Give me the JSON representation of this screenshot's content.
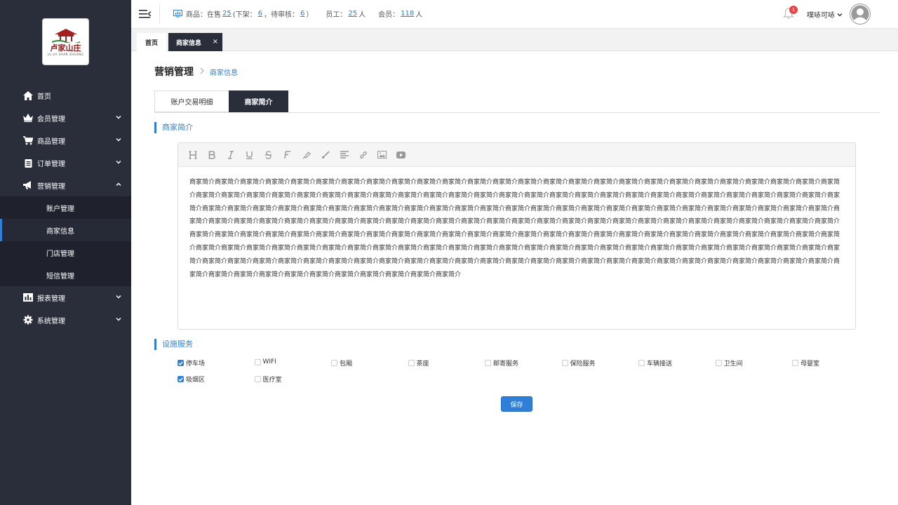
{
  "brand": {
    "logo_text": "卢家山庄",
    "logo_sub": "LU JIA SHAN ZHUANG"
  },
  "sidebar": {
    "items": [
      {
        "label": "首页",
        "icon": "home-icon"
      },
      {
        "label": "会员管理",
        "icon": "crown-icon"
      },
      {
        "label": "商品管理",
        "icon": "cart-icon"
      },
      {
        "label": "订单管理",
        "icon": "clipboard-icon"
      },
      {
        "label": "营销管理",
        "icon": "megaphone-icon"
      },
      {
        "label": "报表管理",
        "icon": "bar-chart-icon"
      },
      {
        "label": "系统管理",
        "icon": "gear-icon"
      }
    ],
    "submenu": [
      {
        "label": "账户管理"
      },
      {
        "label": "商家信息"
      },
      {
        "label": "门店管理"
      },
      {
        "label": "短信管理"
      }
    ]
  },
  "topbar": {
    "goods_label": "商品：在售",
    "on_sale": "25",
    "offshelf_label": "(下架：",
    "offshelf": "6",
    "pending_label": "，待审核：",
    "pending": "6",
    "close_paren": "）",
    "staff_label": "员工：",
    "staff": "25",
    "staff_unit": "人",
    "member_label": "会员：",
    "members": "118",
    "member_unit": "人",
    "notification_count": "1",
    "username": "噗哧可哧"
  },
  "page_tabs": {
    "home": "首页",
    "merchant": "商家信息",
    "close": "×"
  },
  "breadcrumb": {
    "title": "营销管理",
    "current": "商家信息"
  },
  "content_tabs": {
    "tab1": "账户交易明细",
    "tab2": "商家简介"
  },
  "intro": {
    "section_title": "商家简介",
    "text": "商家简介商家简介商家简介商家简介商家简介商家简介商家简介商家简介商家简介商家简介商家简介商家简介商家简介商家简介商家简介商家简介商家简介商家简介商家简介商家简介商家简介商家简介商家简介商家简介商家简介商家简介商家简介商家简介商家简介商家简介商家简介商家简介商家简介商家简介商家简介商家简介商家简介商家简介商家简介商家简介商家简介商家简介商家简介商家简介商家简介商家简介商家简介商家简介商家简介商家简介商家简介商家简介商家简介商家简介商家简介商家简介商家简介商家简介商家简介商家简介商家简介商家简介商家简介商家简介商家简介商家简介商家简介商家简介商家简介商家简介商家简介商家简介商家简介商家简介商家简介商家简介商家简介商家简介商家简介商家简介商家简介商家简介商家简介商家简介商家简介商家简介商家简介商家简介商家简介商家简介商家简介商家简介商家简介商家简介商家简介商家简介商家简介商家简介商家简介商家简介商家简介商家简介商家简介商家简介商家简介商家简介商家简介商家简介商家简介商家简介商家简介商家简介商家简介商家简介商家简介商家简介商家简介商家简介商家简介商家简介商家简介商家简介商家简介商家简介商家简介商家简介商家简介商家简介商家简介商家简介商家简介商家简介商家简介商家简介商家简介商家简介商家简介商家简介商家简介商家简介商家简介商家简介商家简介商家简介商家简介商家简介商家简介商家简介商家简介商家简介商家简介商家简介商家简介商家简介商家简介商家简介商家简介商家简介商家简介商家简介商家简介商家简介商家简介商家简介商家简介商家简介商家简介商家简介商家简介商家简介商家简介商家简介商家简介商家简介商家简介商家简介商家简介商家简介商家简介商家简介商家简介商家简介商家简介商家简介商家简介商家简介商家简介商家简介商家简介商家简介商家简介"
  },
  "editor_toolbar": [
    "heading-icon",
    "bold-icon",
    "italic-icon",
    "underline-icon",
    "strikethrough-icon",
    "font-icon",
    "highlighter-icon",
    "brush-icon",
    "align-icon",
    "link-icon",
    "image-icon",
    "video-icon"
  ],
  "facilities": {
    "section_title": "设施服务",
    "items": [
      {
        "label": "停车场",
        "checked": true
      },
      {
        "label": "WIFI",
        "checked": false
      },
      {
        "label": "包厢",
        "checked": false
      },
      {
        "label": "茶座",
        "checked": false
      },
      {
        "label": "邮寄服务",
        "checked": false
      },
      {
        "label": "保险服务",
        "checked": false
      },
      {
        "label": "车辆接送",
        "checked": false
      },
      {
        "label": "卫生间",
        "checked": false
      },
      {
        "label": "母婴室",
        "checked": false
      },
      {
        "label": "吸烟区",
        "checked": true
      },
      {
        "label": "医疗室",
        "checked": false
      }
    ]
  },
  "save_label": "保存",
  "colors": {
    "sidebar": "#2a2e3b",
    "accent": "#2f7fd8",
    "badge": "#e64545"
  }
}
